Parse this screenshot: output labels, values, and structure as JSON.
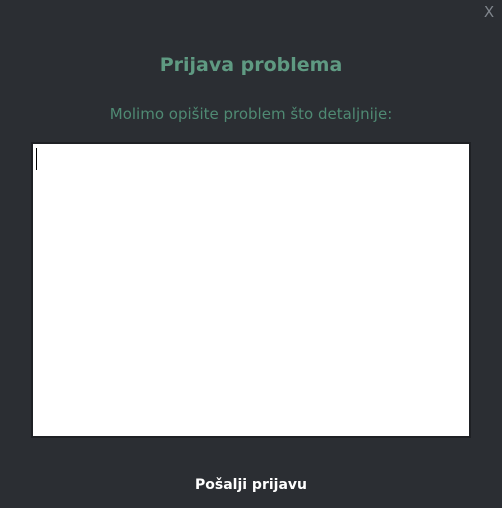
{
  "dialog": {
    "close_label": "X",
    "title": "Prijava problema",
    "subtitle": "Molimo opišite problem što detaljnije:",
    "description": {
      "value": "",
      "placeholder": ""
    },
    "submit_label": "Pošalji prijavu"
  },
  "colors": {
    "background": "#2b2e33",
    "title": "#5f9a82",
    "subtitle": "#4f8a73",
    "submit_text": "#ffffff",
    "close_text": "#7f858c"
  }
}
